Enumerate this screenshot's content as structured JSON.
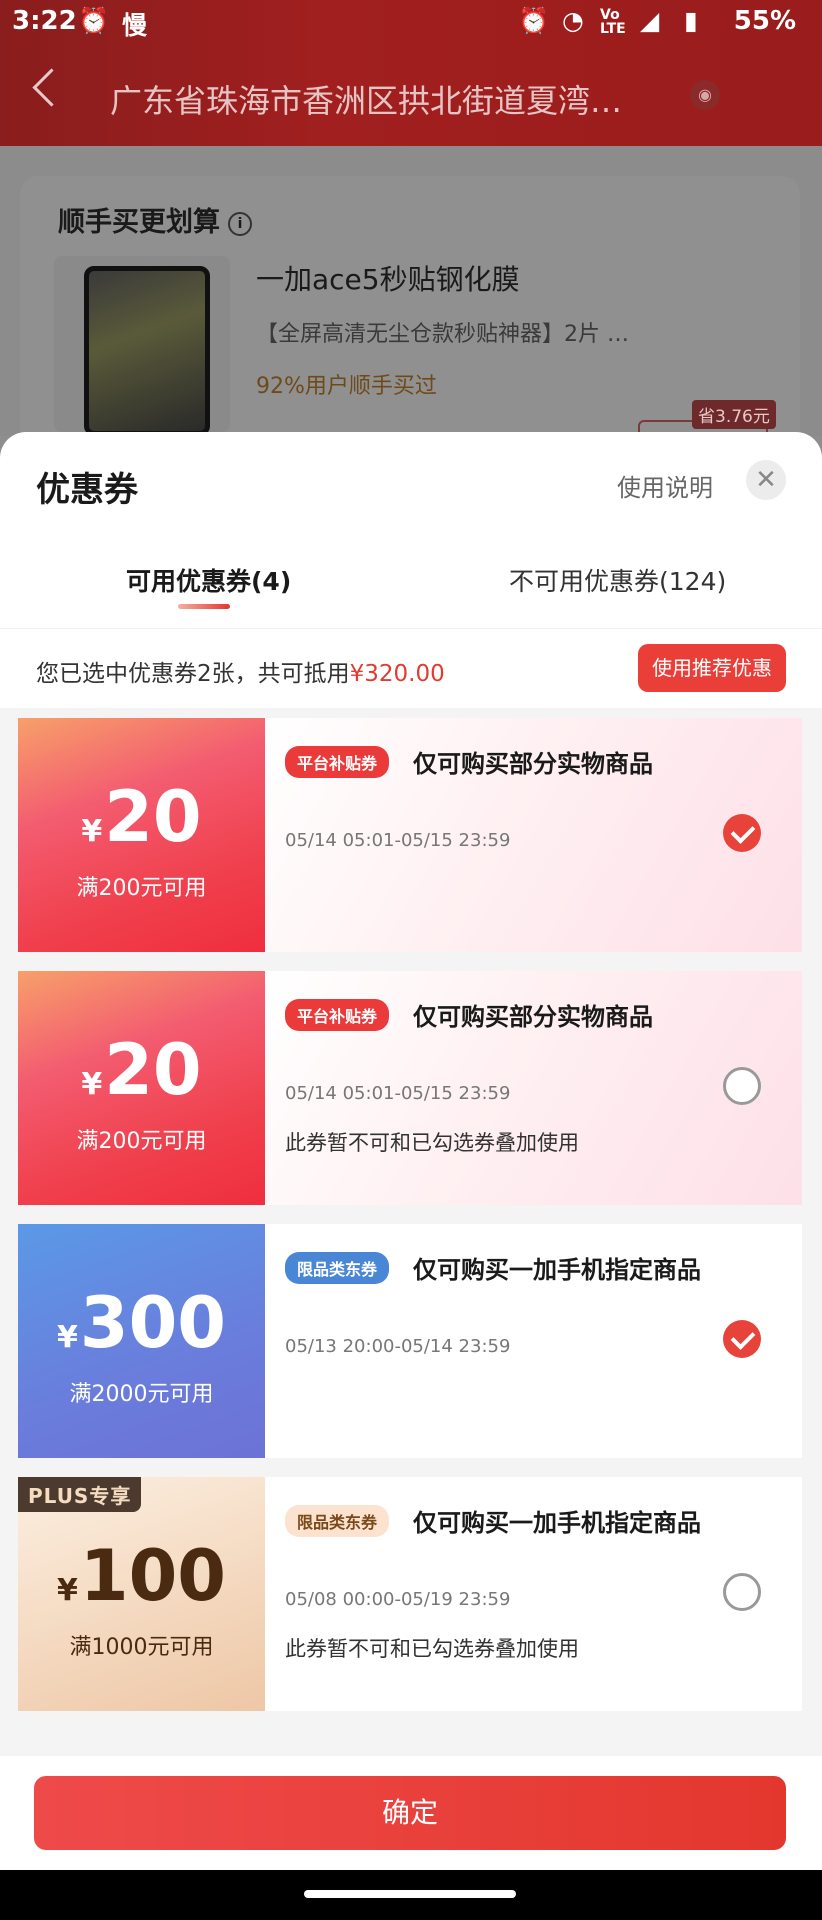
{
  "status_bar": {
    "time": "3:22",
    "icons": [
      "alarm-icon",
      "slow-charge-icon",
      "alarm-icon",
      "wifi-icon",
      "volte-icon",
      "signal-icon",
      "battery-icon"
    ],
    "carrier_text": "慢",
    "battery_pct": "55%"
  },
  "header": {
    "address": "广东省珠海市香洲区拱北街道夏湾…"
  },
  "background_card": {
    "title": "顺手买更划算",
    "product_name": "一加ace5秒贴钢化膜",
    "product_desc": "【全屏高清无尘仓款秒贴神器】2片  …",
    "product_pct": "92%用户顺手买过",
    "save_tag": "省3.76元"
  },
  "sheet": {
    "title": "优惠券",
    "howto": "使用说明",
    "tabs": [
      {
        "label": "可用优惠券(4)",
        "active": true
      },
      {
        "label": "不可用优惠券(124)",
        "active": false
      }
    ],
    "summary_prefix": "您已选中优惠券2张，共可抵用",
    "summary_amount": "¥320.00",
    "recommend_button": "使用推荐优惠",
    "coupons": [
      {
        "yen": "¥",
        "amount": "20",
        "condition": "满200元可用",
        "badge": "平台补贴券",
        "title": "仅可购买部分实物商品",
        "time": "05/14 05:01-05/15 23:59",
        "note": "",
        "checked": true
      },
      {
        "yen": "¥",
        "amount": "20",
        "condition": "满200元可用",
        "badge": "平台补贴券",
        "title": "仅可购买部分实物商品",
        "time": "05/14 05:01-05/15 23:59",
        "note": "此券暂不可和已勾选券叠加使用",
        "checked": false
      },
      {
        "yen": "¥",
        "amount": "300",
        "condition": "满2000元可用",
        "badge": "限品类东券",
        "title": "仅可购买一加手机指定商品",
        "time": "05/13 20:00-05/14 23:59",
        "note": "",
        "checked": true
      },
      {
        "plus_tag": "PLUS专享",
        "yen": "¥",
        "amount": "100",
        "condition": "满1000元可用",
        "badge": "限品类东券",
        "title": "仅可购买一加手机指定商品",
        "time": "05/08 00:00-05/19 23:59",
        "note": "此券暂不可和已勾选券叠加使用",
        "checked": false
      }
    ],
    "confirm_button": "确定"
  },
  "colors": {
    "accent_red": "#ea3f38",
    "header_red": "#a11f1f",
    "coupon_blue": "#5b99e6",
    "plus_gold": "#f3d7bd"
  }
}
